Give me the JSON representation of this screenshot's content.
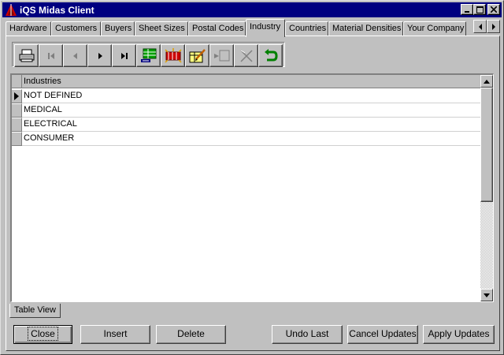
{
  "window": {
    "title": "iQS Midas Client",
    "caption_buttons": {
      "minimize": "minimize-icon",
      "maximize": "maximize-icon",
      "close": "close-icon"
    }
  },
  "tabs": [
    {
      "label": "Hardware",
      "active": false
    },
    {
      "label": "Customers",
      "active": false
    },
    {
      "label": "Buyers",
      "active": false
    },
    {
      "label": "Sheet Sizes",
      "active": false
    },
    {
      "label": "Postal Codes",
      "active": false
    },
    {
      "label": "Industry",
      "active": true
    },
    {
      "label": "Countries",
      "active": false
    },
    {
      "label": "Material Densities",
      "active": false
    },
    {
      "label": "Your Company",
      "active": false
    }
  ],
  "toolbar": {
    "buttons": [
      {
        "icon": "print-icon"
      },
      {
        "icon": "first-record-icon"
      },
      {
        "icon": "prior-record-icon"
      },
      {
        "icon": "next-record-icon"
      },
      {
        "icon": "last-record-icon"
      },
      {
        "icon": "insert-record-icon"
      },
      {
        "icon": "delete-record-icon"
      },
      {
        "icon": "edit-record-icon"
      },
      {
        "icon": "post-record-icon"
      },
      {
        "icon": "cancel-edit-icon"
      },
      {
        "icon": "refresh-icon"
      }
    ]
  },
  "grid": {
    "column_header": "Industries",
    "rows": [
      "NOT DEFINED",
      "MEDICAL",
      "ELECTRICAL",
      "CONSUMER"
    ],
    "current_row": 0
  },
  "sheet_tab": "Table View",
  "buttons": {
    "close": "Close",
    "insert": "Insert",
    "delete": "Delete",
    "undo_last": "Undo Last",
    "cancel_updates": "Cancel Updates",
    "apply_updates": "Apply Updates"
  },
  "colors": {
    "titlebar": "#000080",
    "face": "#c0c0c0",
    "accent_red": "#cc0000"
  }
}
